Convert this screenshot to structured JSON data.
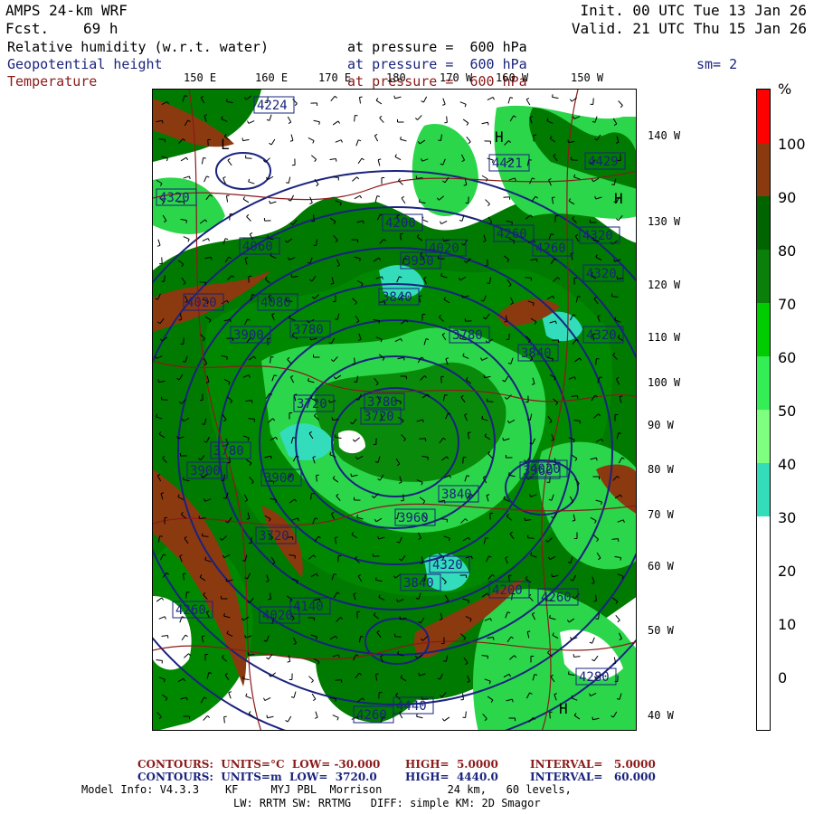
{
  "header": {
    "model": "AMPS 24-km WRF",
    "fcst_label": "Fcst.",
    "fcst_value": "69 h",
    "init": "Init. 00 UTC Tue 13 Jan 26",
    "valid": "Valid. 21 UTC Thu 15 Jan 26"
  },
  "fields": [
    {
      "name": "Relative humidity (w.r.t. water)",
      "level": "at pressure =  600 hPa",
      "color": "#000000"
    },
    {
      "name": "Geopotential height",
      "level": "at pressure =  600 hPa",
      "color": "#1a237e"
    },
    {
      "name": "Temperature",
      "level": "at pressure =  600 hPa",
      "color": "#8b1a1a"
    }
  ],
  "smoothing": "sm= 2",
  "longitude_labels_top": [
    "150 E",
    "160 E",
    "170 E",
    "180",
    "170 W",
    "160 W",
    "150 W"
  ],
  "latitude_labels_right": [
    "140 W",
    "130 W",
    "120 W",
    "110 W",
    "100 W",
    "90 W",
    "80 W",
    "70 W",
    "60 W",
    "50 W",
    "40 W"
  ],
  "colorbar": {
    "unit": "%",
    "labels": [
      "100",
      "90",
      "80",
      "70",
      "60",
      "50",
      "40",
      "30",
      "20",
      "10",
      "0"
    ],
    "colors": [
      "#ff0000",
      "#8b3a0f",
      "#006400",
      "#0a7f0a",
      "#00cc00",
      "#33ee55",
      "#7fff7f",
      "#33ddbb",
      "#ffffff",
      "#ffffff",
      "#ffffff",
      "#ffffff"
    ]
  },
  "height_labels": [
    "4224",
    "4421",
    "4429",
    "4320",
    "4200",
    "4260",
    "4320",
    "4060",
    "4020",
    "4260",
    "4320",
    "3840",
    "3950",
    "4020",
    "4080",
    "3900",
    "3780",
    "3780",
    "3840",
    "4320",
    "3720",
    "3780",
    "3720",
    "3900",
    "3900",
    "3960",
    "3780",
    "3840",
    "4020",
    "3720",
    "3840",
    "4200",
    "4260",
    "4020",
    "4140",
    "3960",
    "4320",
    "4260",
    "4440",
    "4280",
    "4260"
  ],
  "footer": {
    "temp_contours": "CONTOURS:  UNITS=°C  LOW= -30.000",
    "temp_high": "HIGH=  5.0000",
    "temp_interval": "INTERVAL=   5.0000",
    "hgt_contours": "CONTOURS:  UNITS=m  LOW=  3720.0",
    "hgt_high": "HIGH=  4440.0",
    "hgt_interval": "INTERVAL=   60.000",
    "model_info": "Model Info: V4.3.3    KF     MYJ PBL  Morrison          24 km,   60 levels,",
    "model_info2": "LW: RRTM SW: RRTMG   DIFF: simple KM: 2D Smagor"
  }
}
